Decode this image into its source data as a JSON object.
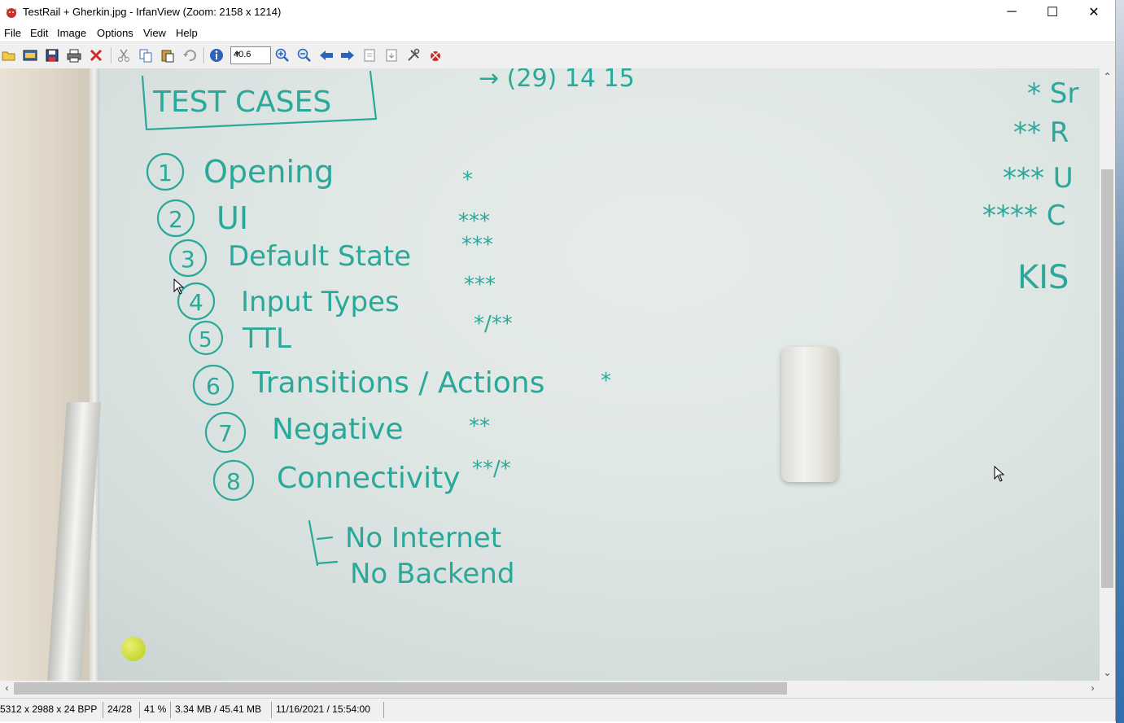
{
  "window": {
    "title": "TestRail + Gherkin.jpg - IrfanView (Zoom: 2158 x 1214)",
    "app_icon": "irfanview-cat-icon",
    "controls": {
      "minimize": "─",
      "maximize": "☐",
      "close": "✕"
    }
  },
  "menu": {
    "items": [
      "File",
      "Edit",
      "Image",
      "Options",
      "View",
      "Help"
    ]
  },
  "toolbar": {
    "zoom_value": "40.6",
    "icons": [
      "open-folder-icon",
      "slideshow-icon",
      "save-icon",
      "print-icon",
      "delete-icon",
      "cut-icon",
      "copy-icon",
      "paste-icon",
      "undo-icon",
      "info-icon",
      "zoom-in-icon",
      "zoom-out-icon",
      "previous-icon",
      "next-icon",
      "first-page-icon",
      "last-page-icon",
      "settings-icon",
      "exit-icon"
    ]
  },
  "image": {
    "board_text": {
      "heading": "TEST CASES",
      "top_fragment": "→ (29) 14 15",
      "cases": [
        {
          "num": "1",
          "label": "Opening",
          "rating": "*"
        },
        {
          "num": "2",
          "label": "UI",
          "rating": "***"
        },
        {
          "num": "3",
          "label": "Default State",
          "rating": "***"
        },
        {
          "num": "4",
          "label": "Input Types",
          "rating": "***"
        },
        {
          "num": "5",
          "label": "TTL",
          "rating": "*/**"
        },
        {
          "num": "6",
          "label": "Transitions / Actions",
          "rating": "*"
        },
        {
          "num": "7",
          "label": "Negative",
          "rating": "**"
        },
        {
          "num": "8",
          "label": "Connectivity",
          "rating": "**/*"
        }
      ],
      "sub_items": [
        "No Internet",
        "No Backend"
      ],
      "right_column": [
        "* Sr",
        "** R",
        "*** U",
        "**** C",
        "KIS"
      ]
    }
  },
  "status": {
    "dimensions": "5312 x 2988 x 24 BPP",
    "index": "24/28",
    "zoom_percent": "41 %",
    "memory": "3.34 MB / 45.41 MB",
    "datetime": "11/16/2021 / 15:54:00"
  }
}
